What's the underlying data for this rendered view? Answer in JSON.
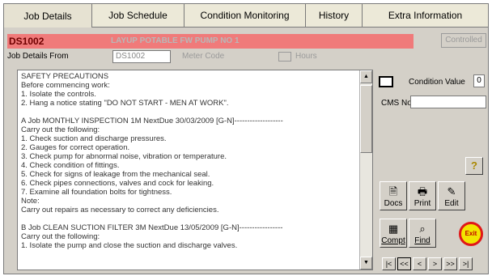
{
  "tabs": [
    {
      "label": "Job Details",
      "active": true
    },
    {
      "label": "Job Schedule",
      "access_key": "S"
    },
    {
      "label": "Condition Monitoring",
      "access_key": "M"
    },
    {
      "label": "History"
    },
    {
      "label": "Extra Information",
      "access_key": "I"
    }
  ],
  "job": {
    "code": "DS1002",
    "name": "LAYUP POTABLE FW PUMP NO 1",
    "controlled_label": "Controlled",
    "details_from_label": "Job Details From",
    "details_from_value": "DS1002",
    "meter_code_label": "Meter Code",
    "hours_label": "Hours"
  },
  "details_text": [
    "SAFETY PRECAUTIONS",
    "Before commencing work:",
    "1. Isolate the controls.",
    "2. Hang a notice stating \"DO NOT START - MEN AT WORK\".",
    "",
    "A Job MONTHLY INSPECTION 1M NextDue 30/03/2009 [G-N]-------------------",
    "Carry out the following:",
    "1. Check suction and discharge pressures.",
    "2. Gauges for correct operation.",
    "3. Check pump for abnormal noise, vibration or temperature.",
    "4. Check condition of fittings.",
    "5. Check for signs of leakage from the mechanical seal.",
    "6. Check pipes connections, valves and cock for leaking.",
    "7. Examine all foundation bolts for tightness.",
    "Note:",
    "Carry out repairs as necessary to correct any deficiencies.",
    "",
    "B Job CLEAN SUCTION FILTER 3M NextDue 13/05/2009 [G-N]-----------------",
    "Carry out the following:",
    "1. Isolate the pump and close the suction and discharge valves."
  ],
  "side": {
    "condition_value_label": "Condition Value",
    "condition_value": "0",
    "cms_no_label": "CMS No",
    "cms_no_value": ""
  },
  "buttons": {
    "docs": "Docs",
    "print": "Print",
    "edit": "Edit",
    "compt": "Compt",
    "find": "Find",
    "exit": "Exit",
    "help": "?"
  },
  "nav": [
    "|<",
    "<<",
    "<",
    ">",
    ">>",
    ">|"
  ]
}
